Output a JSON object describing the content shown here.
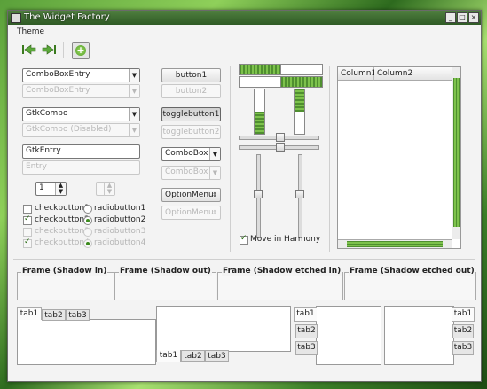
{
  "window": {
    "title": "The Widget Factory"
  },
  "menu": {
    "theme": "Theme"
  },
  "toolbar": {
    "back": "◀",
    "forward": "▶",
    "add": "+"
  },
  "left": {
    "combo_entry": "ComboBoxEntry",
    "combo_entry_disabled": "ComboBoxEntry",
    "gtk_combo": "GtkCombo",
    "gtk_combo_disabled": "GtkCombo (Disabled)",
    "entry": "GtkEntry",
    "entry_disabled": "Entry",
    "spin_value": "1",
    "check1": "checkbutton1",
    "check2": "checkbutton2",
    "check3": "checkbutton3",
    "check4": "checkbutton4",
    "radio1": "radiobutton1",
    "radio2": "radiobutton2",
    "radio3": "radiobutton3",
    "radio4": "radiobutton4"
  },
  "middle": {
    "button1": "button1",
    "button2": "button2",
    "toggle1": "togglebutton1",
    "toggle2": "togglebutton2",
    "combobox": "ComboBox",
    "combobox_disabled": "ComboBox",
    "optionmenu": "OptionMenu",
    "optionmenu_disabled": "OptionMenu"
  },
  "sliders": {
    "harmony_label": "Move in Harmony",
    "h_progress": 0.5,
    "v_progress": 0.5
  },
  "tree": {
    "col1": "Column1",
    "col2": "Column2"
  },
  "frames": {
    "shadow_in": "Frame (Shadow in)",
    "shadow_out": "Frame (Shadow out)",
    "etched_in": "Frame (Shadow etched in)",
    "etched_out": "Frame (Shadow etched out)"
  },
  "tabs": {
    "tab1": "tab1",
    "tab2": "tab2",
    "tab3": "tab3"
  },
  "colors": {
    "accent": "#5a9e34",
    "window_bg": "#f3f3f3"
  }
}
